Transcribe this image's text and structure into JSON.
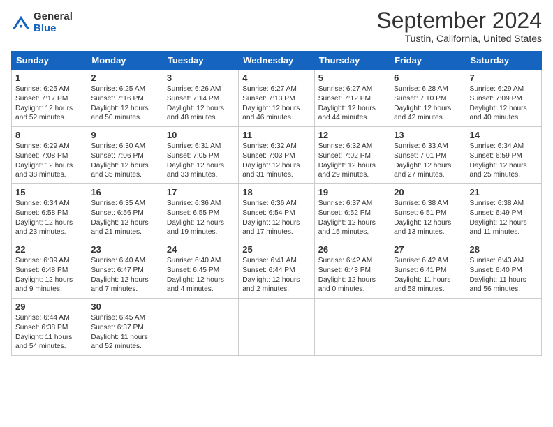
{
  "header": {
    "logo_general": "General",
    "logo_blue": "Blue",
    "month_title": "September 2024",
    "location": "Tustin, California, United States"
  },
  "days_of_week": [
    "Sunday",
    "Monday",
    "Tuesday",
    "Wednesday",
    "Thursday",
    "Friday",
    "Saturday"
  ],
  "weeks": [
    [
      {
        "day": "1",
        "lines": [
          "Sunrise: 6:25 AM",
          "Sunset: 7:17 PM",
          "Daylight: 12 hours",
          "and 52 minutes."
        ]
      },
      {
        "day": "2",
        "lines": [
          "Sunrise: 6:25 AM",
          "Sunset: 7:16 PM",
          "Daylight: 12 hours",
          "and 50 minutes."
        ]
      },
      {
        "day": "3",
        "lines": [
          "Sunrise: 6:26 AM",
          "Sunset: 7:14 PM",
          "Daylight: 12 hours",
          "and 48 minutes."
        ]
      },
      {
        "day": "4",
        "lines": [
          "Sunrise: 6:27 AM",
          "Sunset: 7:13 PM",
          "Daylight: 12 hours",
          "and 46 minutes."
        ]
      },
      {
        "day": "5",
        "lines": [
          "Sunrise: 6:27 AM",
          "Sunset: 7:12 PM",
          "Daylight: 12 hours",
          "and 44 minutes."
        ]
      },
      {
        "day": "6",
        "lines": [
          "Sunrise: 6:28 AM",
          "Sunset: 7:10 PM",
          "Daylight: 12 hours",
          "and 42 minutes."
        ]
      },
      {
        "day": "7",
        "lines": [
          "Sunrise: 6:29 AM",
          "Sunset: 7:09 PM",
          "Daylight: 12 hours",
          "and 40 minutes."
        ]
      }
    ],
    [
      {
        "day": "8",
        "lines": [
          "Sunrise: 6:29 AM",
          "Sunset: 7:08 PM",
          "Daylight: 12 hours",
          "and 38 minutes."
        ]
      },
      {
        "day": "9",
        "lines": [
          "Sunrise: 6:30 AM",
          "Sunset: 7:06 PM",
          "Daylight: 12 hours",
          "and 35 minutes."
        ]
      },
      {
        "day": "10",
        "lines": [
          "Sunrise: 6:31 AM",
          "Sunset: 7:05 PM",
          "Daylight: 12 hours",
          "and 33 minutes."
        ]
      },
      {
        "day": "11",
        "lines": [
          "Sunrise: 6:32 AM",
          "Sunset: 7:03 PM",
          "Daylight: 12 hours",
          "and 31 minutes."
        ]
      },
      {
        "day": "12",
        "lines": [
          "Sunrise: 6:32 AM",
          "Sunset: 7:02 PM",
          "Daylight: 12 hours",
          "and 29 minutes."
        ]
      },
      {
        "day": "13",
        "lines": [
          "Sunrise: 6:33 AM",
          "Sunset: 7:01 PM",
          "Daylight: 12 hours",
          "and 27 minutes."
        ]
      },
      {
        "day": "14",
        "lines": [
          "Sunrise: 6:34 AM",
          "Sunset: 6:59 PM",
          "Daylight: 12 hours",
          "and 25 minutes."
        ]
      }
    ],
    [
      {
        "day": "15",
        "lines": [
          "Sunrise: 6:34 AM",
          "Sunset: 6:58 PM",
          "Daylight: 12 hours",
          "and 23 minutes."
        ]
      },
      {
        "day": "16",
        "lines": [
          "Sunrise: 6:35 AM",
          "Sunset: 6:56 PM",
          "Daylight: 12 hours",
          "and 21 minutes."
        ]
      },
      {
        "day": "17",
        "lines": [
          "Sunrise: 6:36 AM",
          "Sunset: 6:55 PM",
          "Daylight: 12 hours",
          "and 19 minutes."
        ]
      },
      {
        "day": "18",
        "lines": [
          "Sunrise: 6:36 AM",
          "Sunset: 6:54 PM",
          "Daylight: 12 hours",
          "and 17 minutes."
        ]
      },
      {
        "day": "19",
        "lines": [
          "Sunrise: 6:37 AM",
          "Sunset: 6:52 PM",
          "Daylight: 12 hours",
          "and 15 minutes."
        ]
      },
      {
        "day": "20",
        "lines": [
          "Sunrise: 6:38 AM",
          "Sunset: 6:51 PM",
          "Daylight: 12 hours",
          "and 13 minutes."
        ]
      },
      {
        "day": "21",
        "lines": [
          "Sunrise: 6:38 AM",
          "Sunset: 6:49 PM",
          "Daylight: 12 hours",
          "and 11 minutes."
        ]
      }
    ],
    [
      {
        "day": "22",
        "lines": [
          "Sunrise: 6:39 AM",
          "Sunset: 6:48 PM",
          "Daylight: 12 hours",
          "and 9 minutes."
        ]
      },
      {
        "day": "23",
        "lines": [
          "Sunrise: 6:40 AM",
          "Sunset: 6:47 PM",
          "Daylight: 12 hours",
          "and 7 minutes."
        ]
      },
      {
        "day": "24",
        "lines": [
          "Sunrise: 6:40 AM",
          "Sunset: 6:45 PM",
          "Daylight: 12 hours",
          "and 4 minutes."
        ]
      },
      {
        "day": "25",
        "lines": [
          "Sunrise: 6:41 AM",
          "Sunset: 6:44 PM",
          "Daylight: 12 hours",
          "and 2 minutes."
        ]
      },
      {
        "day": "26",
        "lines": [
          "Sunrise: 6:42 AM",
          "Sunset: 6:43 PM",
          "Daylight: 12 hours",
          "and 0 minutes."
        ]
      },
      {
        "day": "27",
        "lines": [
          "Sunrise: 6:42 AM",
          "Sunset: 6:41 PM",
          "Daylight: 11 hours",
          "and 58 minutes."
        ]
      },
      {
        "day": "28",
        "lines": [
          "Sunrise: 6:43 AM",
          "Sunset: 6:40 PM",
          "Daylight: 11 hours",
          "and 56 minutes."
        ]
      }
    ],
    [
      {
        "day": "29",
        "lines": [
          "Sunrise: 6:44 AM",
          "Sunset: 6:38 PM",
          "Daylight: 11 hours",
          "and 54 minutes."
        ]
      },
      {
        "day": "30",
        "lines": [
          "Sunrise: 6:45 AM",
          "Sunset: 6:37 PM",
          "Daylight: 11 hours",
          "and 52 minutes."
        ]
      },
      null,
      null,
      null,
      null,
      null
    ]
  ]
}
